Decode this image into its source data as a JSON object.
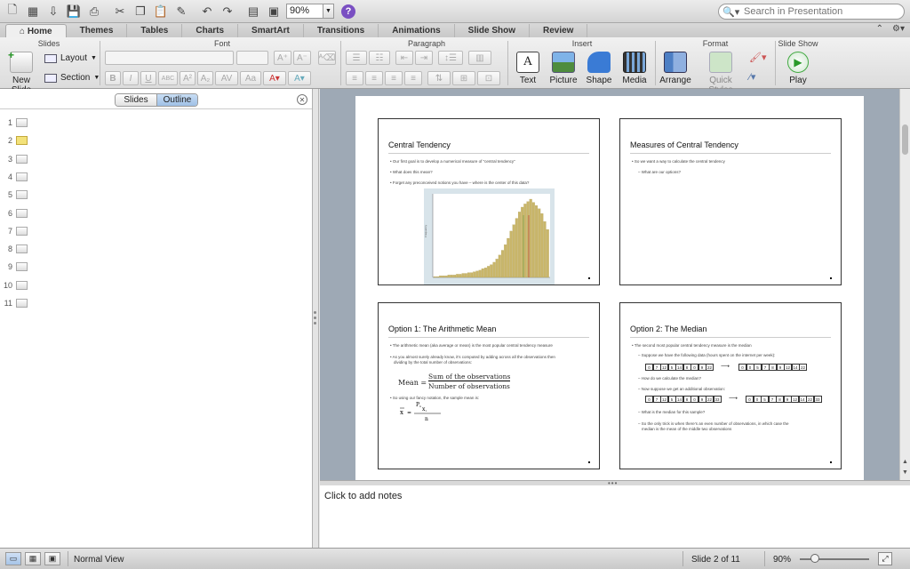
{
  "toolbar": {
    "zoom": "90%",
    "help": "?",
    "search_placeholder": "Search in Presentation"
  },
  "tabs": [
    "Home",
    "Themes",
    "Tables",
    "Charts",
    "SmartArt",
    "Transitions",
    "Animations",
    "Slide Show",
    "Review"
  ],
  "ribbon": {
    "groups": {
      "slides": "Slides",
      "font": "Font",
      "paragraph": "Paragraph",
      "insert": "Insert",
      "format": "Format",
      "slideshow": "Slide Show"
    },
    "new_slide": "New Slide",
    "layout": "Layout",
    "section": "Section",
    "text": "Text",
    "picture": "Picture",
    "shape": "Shape",
    "media": "Media",
    "arrange": "Arrange",
    "quick_styles": "Quick Styles",
    "play": "Play"
  },
  "left_pane": {
    "tab_slides": "Slides",
    "tab_outline": "Outline",
    "slide_numbers": [
      "1",
      "2",
      "3",
      "4",
      "5",
      "6",
      "7",
      "8",
      "9",
      "10",
      "11"
    ],
    "selected": 2
  },
  "slides": {
    "s1": {
      "title": "Central Tendency",
      "bullets": [
        "• Our first goal is to develop a numerical measure of “central tendency”",
        "• What does this mean?",
        "• Forget any preconceived notions you have – where is the center of this data?"
      ],
      "histogram": [
        1,
        1,
        2,
        2,
        2,
        3,
        3,
        3,
        4,
        4,
        5,
        5,
        6,
        6,
        7,
        8,
        9,
        11,
        12,
        14,
        16,
        19,
        23,
        28,
        34,
        41,
        49,
        58,
        66,
        74,
        82,
        88,
        92,
        95,
        98,
        94,
        90,
        86,
        80,
        70,
        60
      ]
    },
    "s2": {
      "title": "Measures of Central Tendency",
      "bullets": [
        "• So we want a way to calculate the central tendency",
        "– What are our options?"
      ]
    },
    "s3": {
      "title": "Option 1: The Arithmetic Mean",
      "bullets": [
        "• The arithmetic mean (aka average or mean) is the most popular central tendency measure",
        "• As you almost surely already know, it’s computed by adding across all the observations then",
        "dividing by the total number of observations:",
        "• So using our fancy notation, the sample mean is:"
      ],
      "mean_label": "Mean =",
      "numerator": "Sum of the observations",
      "denominator": "Number of observations"
    },
    "s4": {
      "title": "Option 2: The Median",
      "bullets": [
        "• The second most popular central tendency measure is the median",
        "– Suppose we have the following data (hours spent on the internet per week):",
        "– How do we calculate the median?",
        "– Now suppose we get an additional observation:",
        "– What is the median for this sample?",
        "– So the only trick is when there’s an even number of observations, in which case the",
        "median is the mean of the middle two observations"
      ],
      "row1": [
        "0",
        "7",
        "12",
        "5",
        "14",
        "8",
        "0",
        "9",
        "22"
      ],
      "row1_sorted": [
        "0",
        "0",
        "5",
        "7",
        "8",
        "9",
        "12",
        "14",
        "22"
      ],
      "row2": [
        "0",
        "7",
        "12",
        "5",
        "14",
        "8",
        "0",
        "9",
        "22",
        "33"
      ],
      "row2_sorted": [
        "0",
        "0",
        "5",
        "7",
        "8",
        "9",
        "12",
        "14",
        "22",
        "33"
      ]
    }
  },
  "notes_placeholder": "Click to add notes",
  "status": {
    "view": "Normal View",
    "slide_info": "Slide 2 of 11",
    "zoom": "90%"
  }
}
